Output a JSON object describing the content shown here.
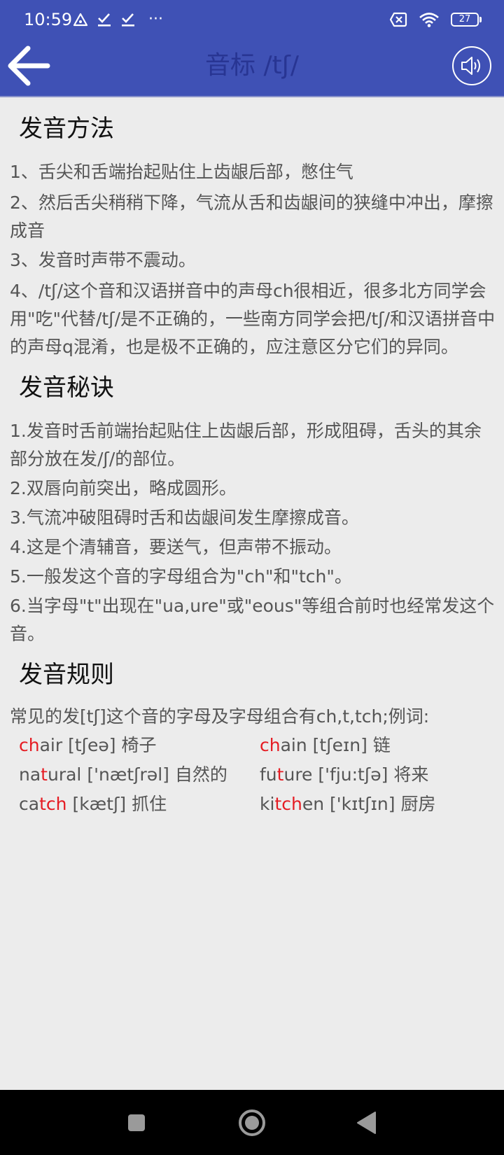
{
  "status_bar": {
    "time": "10:59",
    "more": "···",
    "battery": "27"
  },
  "app_bar": {
    "title": "音标 /tʃ/"
  },
  "sections": [
    {
      "title": "发音方法",
      "items": [
        "1、舌尖和舌端抬起贴住上齿龈后部，憋住气",
        "2、然后舌尖稍稍下降，气流从舌和齿龈间的狭缝中冲出，摩擦成音",
        "3、发音时声带不震动。",
        "4、/tʃ/这个音和汉语拼音中的声母ch很相近，很多北方同学会用\"吃\"代替/tʃ/是不正确的，一些南方同学会把/tʃ/和汉语拼音中的声母q混淆，也是极不正确的，应注意区分它们的异同。"
      ]
    },
    {
      "title": "发音秘诀",
      "items": [
        "1.发音时舌前端抬起贴住上齿龈后部，形成阻碍，舌头的其余部分放在发/ʃ/的部位。",
        "2.双唇向前突出，略成圆形。",
        "3.气流冲破阻碍时舌和齿龈间发生摩擦成音。",
        "4.这是个清辅音，要送气，但声带不振动。",
        "5.一般发这个音的字母组合为\"ch\"和\"tch\"。",
        "6.当字母\"t\"出现在\"ua,ure\"或\"eous\"等组合前时也经常发这个音。"
      ]
    },
    {
      "title": "发音规则",
      "intro": "常见的发[tʃ]这个音的字母及字母组合有ch,t,tch;例词:"
    }
  ],
  "examples": [
    {
      "pre": "",
      "hl": "ch",
      "post": "air",
      "ipa": "[tʃeə]",
      "meaning": "椅子"
    },
    {
      "pre": "",
      "hl": "ch",
      "post": "ain",
      "ipa": "[tʃeɪn]",
      "meaning": "链"
    },
    {
      "pre": "na",
      "hl": "t",
      "post": "ural",
      "ipa": "['nætʃrəl]",
      "meaning": "自然的"
    },
    {
      "pre": "fu",
      "hl": "t",
      "post": "ure",
      "ipa": "['fju:tʃə]",
      "meaning": "将来"
    },
    {
      "pre": "ca",
      "hl": "tch",
      "post": "",
      "ipa": "[kætʃ]",
      "meaning": "抓住"
    },
    {
      "pre": "ki",
      "hl": "tch",
      "post": "en",
      "ipa": "['kɪtʃɪn]",
      "meaning": "厨房"
    }
  ],
  "colors": {
    "primary": "#3f51b5",
    "title_text": "#283593",
    "highlight": "#e51c23",
    "background": "#ececec"
  }
}
